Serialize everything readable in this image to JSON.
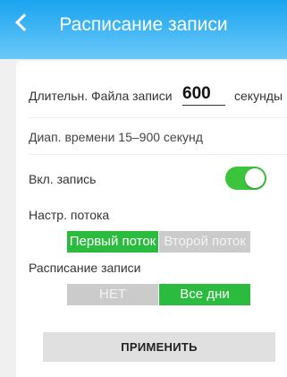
{
  "header": {
    "title": "Расписание записи"
  },
  "duration": {
    "label": "Длительн. Файла записи",
    "value": "600",
    "unit": "секунды"
  },
  "range": {
    "text": "Диап. времени 15–900 секунд"
  },
  "recording": {
    "label": "Вкл. запись",
    "enabled": true
  },
  "stream": {
    "label": "Настр. потока",
    "options": [
      "Первый поток",
      "Второй поток"
    ],
    "selected": 0
  },
  "schedule": {
    "label": "Расписание записи",
    "options": [
      "НЕТ",
      "Все дни"
    ],
    "selected": 1
  },
  "apply_label": "ПРИМЕНИТЬ",
  "colors": {
    "accent": "#2bbb3f",
    "header": "#19a4f0",
    "inactive": "#cbcbcb"
  }
}
